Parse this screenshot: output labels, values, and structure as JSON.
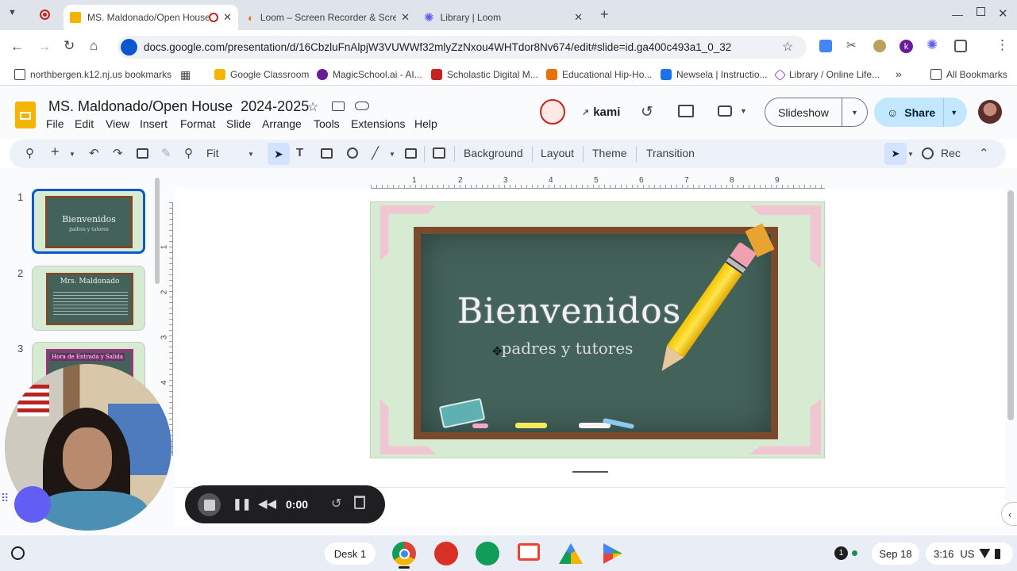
{
  "browser": {
    "tabs": [
      {
        "title": "MS. Maldonado/Open House",
        "active": true
      },
      {
        "title": "Loom – Screen Recorder & Screen",
        "active": false
      },
      {
        "title": "Library | Loom",
        "active": false
      }
    ],
    "url": "docs.google.com/presentation/d/16CbzluFnAlpjW3VUWWf32mlyZzNxou4WHTdor8Nv674/edit#slide=id.ga400c493a1_0_32",
    "bookmarks": [
      "northbergen.k12.nj.us bookmarks",
      "Google Classroom",
      "MagicSchool.ai - AI...",
      "Scholastic Digital M...",
      "Educational Hip-Ho...",
      "Newsela | Instructio...",
      "Library / Online Life..."
    ],
    "all_bookmarks": "All Bookmarks"
  },
  "docs": {
    "title": "MS. Maldonado/Open House  2024-2025",
    "menus": [
      "File",
      "Edit",
      "View",
      "Insert",
      "Format",
      "Slide",
      "Arrange",
      "Tools",
      "Extensions",
      "Help"
    ],
    "kami": "kami",
    "slideshow": "Slideshow",
    "share": "Share",
    "toolbar": {
      "zoom": "Fit",
      "background": "Background",
      "layout": "Layout",
      "theme": "Theme",
      "transition": "Transition",
      "rec": "Rec"
    },
    "ruler_h": [
      "1",
      "2",
      "3",
      "4",
      "5",
      "6",
      "7",
      "8",
      "9"
    ],
    "ruler_v": [
      "1",
      "2",
      "3",
      "4"
    ],
    "slide_numbers": [
      "1",
      "2",
      "3"
    ],
    "thumbnails": {
      "t1_title": "Bienvenidos",
      "t1_sub": "padres y tutores",
      "t2_title": "Mrs. Maldonado",
      "t3_title": "Hora de Entrada y Salida"
    },
    "slide": {
      "title": "Bienvenidos",
      "subtitle": "padres y tutores"
    }
  },
  "recorder": {
    "time": "0:00"
  },
  "taskbar": {
    "desk": "Desk 1",
    "notification_count": "1",
    "date": "Sep 18",
    "time": "3:16",
    "locale": "US"
  },
  "colors": {
    "accent": "#0b57d0",
    "share_bg": "#c2e7ff",
    "chalkboard": "#43625a",
    "slide_bg": "#d6ebd2"
  }
}
